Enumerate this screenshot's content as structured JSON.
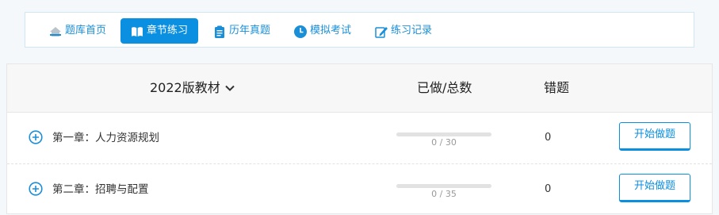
{
  "tabs": [
    {
      "label": "题库首页",
      "icon": "home-icon"
    },
    {
      "label": "章节练习",
      "icon": "book-icon",
      "active": true
    },
    {
      "label": "历年真题",
      "icon": "clipboard-icon"
    },
    {
      "label": "模拟考试",
      "icon": "clock-icon"
    },
    {
      "label": "练习记录",
      "icon": "pencil-icon"
    }
  ],
  "table": {
    "edition_label": "2022版教材",
    "done_total_header": "已做/总数",
    "wrong_header": "错题",
    "rows": [
      {
        "chapter": "第一章：人力资源规划",
        "done": 0,
        "total": 30,
        "progress_text": "0 / 30",
        "wrong": "0",
        "button": "开始做题"
      },
      {
        "chapter": "第二章：招聘与配置",
        "done": 0,
        "total": 35,
        "progress_text": "0 / 35",
        "wrong": "0",
        "button": "开始做题"
      }
    ]
  },
  "colors": {
    "accent": "#0b8fe0",
    "header_bg": "#f7f7f7"
  }
}
